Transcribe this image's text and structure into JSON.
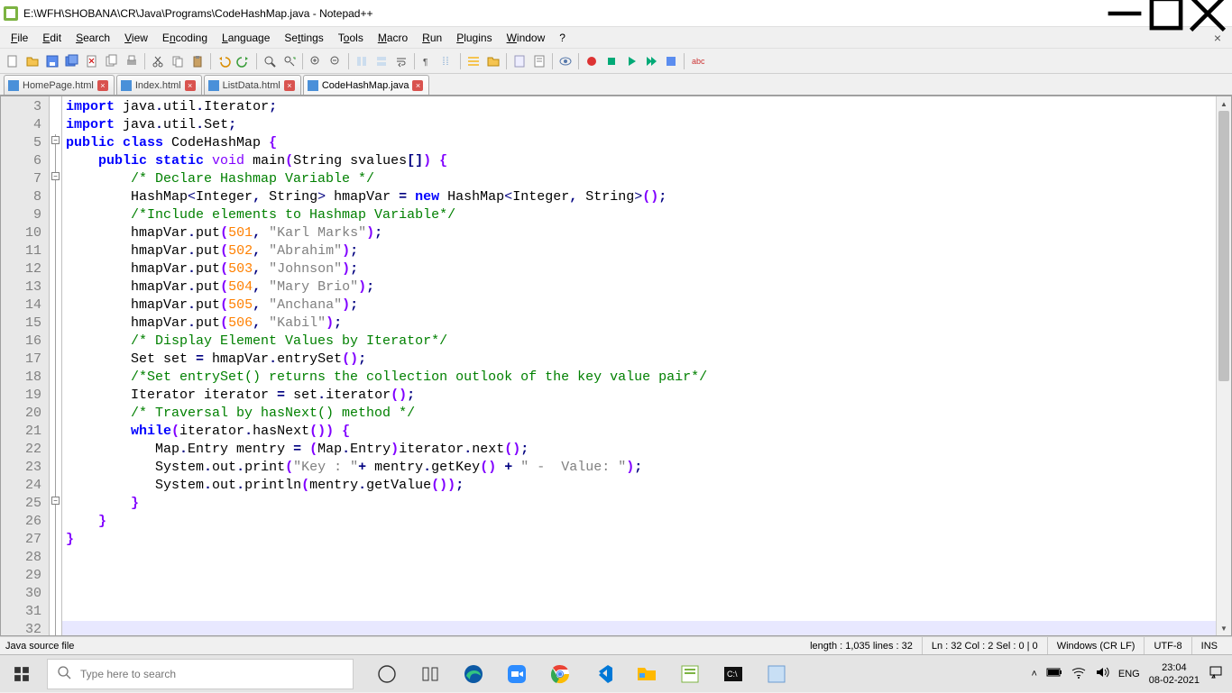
{
  "window": {
    "title": "E:\\WFH\\SHOBANA\\CR\\Java\\Programs\\CodeHashMap.java - Notepad++"
  },
  "menu": {
    "file": "File",
    "edit": "Edit",
    "search": "Search",
    "view": "View",
    "encoding": "Encoding",
    "language": "Language",
    "settings": "Settings",
    "tools": "Tools",
    "macro": "Macro",
    "run": "Run",
    "plugins": "Plugins",
    "window": "Window",
    "help": "?"
  },
  "tabs": [
    {
      "label": "HomePage.html",
      "active": false
    },
    {
      "label": "Index.html",
      "active": false
    },
    {
      "label": "ListData.html",
      "active": false
    },
    {
      "label": "CodeHashMap.java",
      "active": true
    }
  ],
  "code": {
    "first_line_no": 3,
    "lines": [
      {
        "n": 3,
        "segs": [
          [
            "kw",
            "import"
          ],
          [
            "punc",
            " java"
          ],
          [
            "op",
            "."
          ],
          [
            "punc",
            "util"
          ],
          [
            "op",
            "."
          ],
          [
            "punc",
            "Iterator"
          ],
          [
            "op",
            ";"
          ]
        ]
      },
      {
        "n": 4,
        "segs": [
          [
            "kw",
            "import"
          ],
          [
            "punc",
            " java"
          ],
          [
            "op",
            "."
          ],
          [
            "punc",
            "util"
          ],
          [
            "op",
            "."
          ],
          [
            "punc",
            "Set"
          ],
          [
            "op",
            ";"
          ]
        ]
      },
      {
        "n": 5,
        "segs": [
          [
            "kw",
            "public class"
          ],
          [
            "punc",
            " CodeHashMap "
          ],
          [
            "brace",
            "{"
          ]
        ]
      },
      {
        "n": 6,
        "segs": [
          [
            "punc",
            ""
          ]
        ]
      },
      {
        "n": 7,
        "segs": [
          [
            "punc",
            "    "
          ],
          [
            "kw",
            "public static "
          ],
          [
            "kw2",
            "void"
          ],
          [
            "punc",
            " main"
          ],
          [
            "paren",
            "("
          ],
          [
            "punc",
            "String svalues"
          ],
          [
            "op",
            "[]"
          ],
          [
            "paren",
            ")"
          ],
          [
            "punc",
            " "
          ],
          [
            "brace",
            "{"
          ]
        ]
      },
      {
        "n": 8,
        "segs": [
          [
            "punc",
            ""
          ]
        ]
      },
      {
        "n": 9,
        "segs": [
          [
            "punc",
            "        "
          ],
          [
            "cmt",
            "/* Declare Hashmap Variable */"
          ]
        ]
      },
      {
        "n": 10,
        "segs": [
          [
            "punc",
            "        HashMap"
          ],
          [
            "gt",
            "<"
          ],
          [
            "punc",
            "Integer"
          ],
          [
            "op",
            ","
          ],
          [
            "punc",
            " String"
          ],
          [
            "gt",
            ">"
          ],
          [
            "punc",
            " hmapVar "
          ],
          [
            "op",
            "="
          ],
          [
            "punc",
            " "
          ],
          [
            "kw",
            "new"
          ],
          [
            "punc",
            " HashMap"
          ],
          [
            "gt",
            "<"
          ],
          [
            "punc",
            "Integer"
          ],
          [
            "op",
            ","
          ],
          [
            "punc",
            " String"
          ],
          [
            "gt",
            ">"
          ],
          [
            "paren",
            "()"
          ],
          [
            "op",
            ";"
          ]
        ]
      },
      {
        "n": 11,
        "segs": [
          [
            "punc",
            ""
          ]
        ]
      },
      {
        "n": 12,
        "segs": [
          [
            "punc",
            "        "
          ],
          [
            "cmt",
            "/*Include elements to Hashmap Variable*/"
          ]
        ]
      },
      {
        "n": 13,
        "segs": [
          [
            "punc",
            "        hmapVar"
          ],
          [
            "op",
            "."
          ],
          [
            "punc",
            "put"
          ],
          [
            "paren",
            "("
          ],
          [
            "num",
            "501"
          ],
          [
            "op",
            ","
          ],
          [
            "punc",
            " "
          ],
          [
            "str",
            "\"Karl Marks\""
          ],
          [
            "paren",
            ")"
          ],
          [
            "op",
            ";"
          ]
        ]
      },
      {
        "n": 14,
        "segs": [
          [
            "punc",
            "        hmapVar"
          ],
          [
            "op",
            "."
          ],
          [
            "punc",
            "put"
          ],
          [
            "paren",
            "("
          ],
          [
            "num",
            "502"
          ],
          [
            "op",
            ","
          ],
          [
            "punc",
            " "
          ],
          [
            "str",
            "\"Abrahim\""
          ],
          [
            "paren",
            ")"
          ],
          [
            "op",
            ";"
          ]
        ]
      },
      {
        "n": 15,
        "segs": [
          [
            "punc",
            "        hmapVar"
          ],
          [
            "op",
            "."
          ],
          [
            "punc",
            "put"
          ],
          [
            "paren",
            "("
          ],
          [
            "num",
            "503"
          ],
          [
            "op",
            ","
          ],
          [
            "punc",
            " "
          ],
          [
            "str",
            "\"Johnson\""
          ],
          [
            "paren",
            ")"
          ],
          [
            "op",
            ";"
          ]
        ]
      },
      {
        "n": 16,
        "segs": [
          [
            "punc",
            "        hmapVar"
          ],
          [
            "op",
            "."
          ],
          [
            "punc",
            "put"
          ],
          [
            "paren",
            "("
          ],
          [
            "num",
            "504"
          ],
          [
            "op",
            ","
          ],
          [
            "punc",
            " "
          ],
          [
            "str",
            "\"Mary Brio\""
          ],
          [
            "paren",
            ")"
          ],
          [
            "op",
            ";"
          ]
        ]
      },
      {
        "n": 17,
        "segs": [
          [
            "punc",
            "        hmapVar"
          ],
          [
            "op",
            "."
          ],
          [
            "punc",
            "put"
          ],
          [
            "paren",
            "("
          ],
          [
            "num",
            "505"
          ],
          [
            "op",
            ","
          ],
          [
            "punc",
            " "
          ],
          [
            "str",
            "\"Anchana\""
          ],
          [
            "paren",
            ")"
          ],
          [
            "op",
            ";"
          ]
        ]
      },
      {
        "n": 18,
        "segs": [
          [
            "punc",
            "        hmapVar"
          ],
          [
            "op",
            "."
          ],
          [
            "punc",
            "put"
          ],
          [
            "paren",
            "("
          ],
          [
            "num",
            "506"
          ],
          [
            "op",
            ","
          ],
          [
            "punc",
            " "
          ],
          [
            "str",
            "\"Kabil\""
          ],
          [
            "paren",
            ")"
          ],
          [
            "op",
            ";"
          ]
        ]
      },
      {
        "n": 19,
        "segs": [
          [
            "punc",
            ""
          ]
        ]
      },
      {
        "n": 20,
        "segs": [
          [
            "punc",
            "        "
          ],
          [
            "cmt",
            "/* Display Element Values by Iterator*/"
          ]
        ]
      },
      {
        "n": 21,
        "segs": [
          [
            "punc",
            "        Set set "
          ],
          [
            "op",
            "="
          ],
          [
            "punc",
            " hmapVar"
          ],
          [
            "op",
            "."
          ],
          [
            "punc",
            "entrySet"
          ],
          [
            "paren",
            "()"
          ],
          [
            "op",
            ";"
          ]
        ]
      },
      {
        "n": 22,
        "segs": [
          [
            "punc",
            "        "
          ],
          [
            "cmt",
            "/*Set entrySet() returns the collection outlook of the key value pair*/"
          ]
        ]
      },
      {
        "n": 23,
        "segs": [
          [
            "punc",
            "        Iterator iterator "
          ],
          [
            "op",
            "="
          ],
          [
            "punc",
            " set"
          ],
          [
            "op",
            "."
          ],
          [
            "punc",
            "iterator"
          ],
          [
            "paren",
            "()"
          ],
          [
            "op",
            ";"
          ]
        ]
      },
      {
        "n": 24,
        "segs": [
          [
            "punc",
            "        "
          ],
          [
            "cmt",
            "/* Traversal by hasNext() method */"
          ]
        ]
      },
      {
        "n": 25,
        "segs": [
          [
            "punc",
            "        "
          ],
          [
            "kw",
            "while"
          ],
          [
            "paren",
            "("
          ],
          [
            "punc",
            "iterator"
          ],
          [
            "op",
            "."
          ],
          [
            "punc",
            "hasNext"
          ],
          [
            "paren",
            "()"
          ],
          [
            "paren",
            ")"
          ],
          [
            "punc",
            " "
          ],
          [
            "brace",
            "{"
          ]
        ]
      },
      {
        "n": 26,
        "segs": [
          [
            "punc",
            "           Map"
          ],
          [
            "op",
            "."
          ],
          [
            "punc",
            "Entry mentry "
          ],
          [
            "op",
            "="
          ],
          [
            "punc",
            " "
          ],
          [
            "paren",
            "("
          ],
          [
            "punc",
            "Map"
          ],
          [
            "op",
            "."
          ],
          [
            "punc",
            "Entry"
          ],
          [
            "paren",
            ")"
          ],
          [
            "punc",
            "iterator"
          ],
          [
            "op",
            "."
          ],
          [
            "punc",
            "next"
          ],
          [
            "paren",
            "()"
          ],
          [
            "op",
            ";"
          ]
        ]
      },
      {
        "n": 27,
        "segs": [
          [
            "punc",
            "           System"
          ],
          [
            "op",
            "."
          ],
          [
            "punc",
            "out"
          ],
          [
            "op",
            "."
          ],
          [
            "punc",
            "print"
          ],
          [
            "paren",
            "("
          ],
          [
            "str",
            "\"Key : \""
          ],
          [
            "op",
            "+"
          ],
          [
            "punc",
            " mentry"
          ],
          [
            "op",
            "."
          ],
          [
            "punc",
            "getKey"
          ],
          [
            "paren",
            "()"
          ],
          [
            "punc",
            " "
          ],
          [
            "op",
            "+"
          ],
          [
            "punc",
            " "
          ],
          [
            "str",
            "\" -  Value: \""
          ],
          [
            "paren",
            ")"
          ],
          [
            "op",
            ";"
          ]
        ]
      },
      {
        "n": 28,
        "segs": [
          [
            "punc",
            "           System"
          ],
          [
            "op",
            "."
          ],
          [
            "punc",
            "out"
          ],
          [
            "op",
            "."
          ],
          [
            "punc",
            "println"
          ],
          [
            "paren",
            "("
          ],
          [
            "punc",
            "mentry"
          ],
          [
            "op",
            "."
          ],
          [
            "punc",
            "getValue"
          ],
          [
            "paren",
            "()"
          ],
          [
            "paren",
            ")"
          ],
          [
            "op",
            ";"
          ]
        ]
      },
      {
        "n": 29,
        "segs": [
          [
            "punc",
            "        "
          ],
          [
            "brace",
            "}"
          ]
        ]
      },
      {
        "n": 30,
        "segs": [
          [
            "punc",
            ""
          ]
        ]
      },
      {
        "n": 31,
        "segs": [
          [
            "punc",
            "    "
          ],
          [
            "brace",
            "}"
          ]
        ]
      },
      {
        "n": 32,
        "segs": [
          [
            "brace",
            "}"
          ]
        ],
        "highlight": true
      }
    ]
  },
  "status": {
    "filetype": "Java source file",
    "length": "length : 1,035    lines : 32",
    "pos": "Ln : 32    Col : 2    Sel : 0 | 0",
    "eol": "Windows (CR LF)",
    "enc": "UTF-8",
    "ins": "INS"
  },
  "taskbar": {
    "search_placeholder": "Type here to search",
    "lang": "ENG",
    "time": "23:04",
    "date": "08-02-2021"
  }
}
